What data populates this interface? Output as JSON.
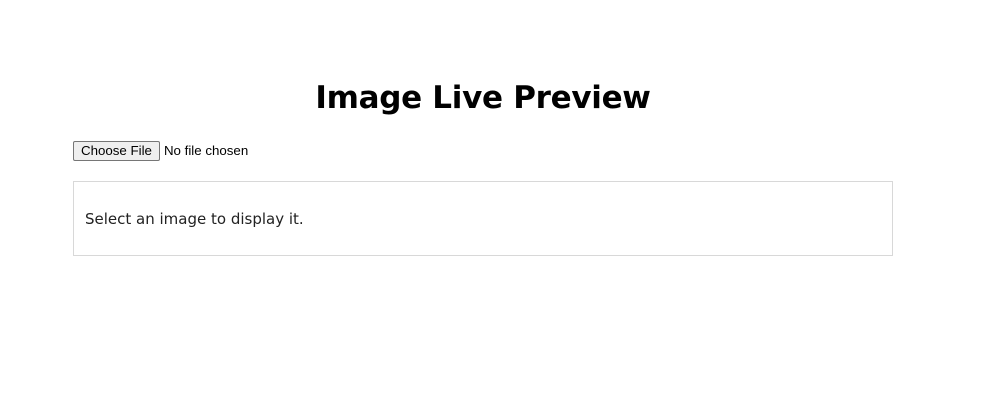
{
  "page": {
    "title": "Image Live Preview"
  },
  "file_input": {
    "button_label": "Choose File",
    "status_text": "No file chosen"
  },
  "preview": {
    "message": "Select an image to display it."
  }
}
